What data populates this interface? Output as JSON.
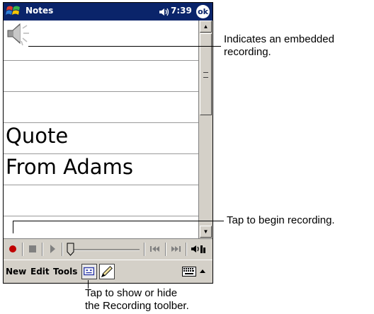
{
  "titlebar": {
    "app_title": "Notes",
    "time": "7:39",
    "ok_label": "ok",
    "bg_color": "#0a246a"
  },
  "note": {
    "lines": [
      "Quote",
      "From Adams"
    ],
    "embedded_recording_icon": "speaker-icon"
  },
  "recording_toolbar": {
    "buttons": [
      "record-icon",
      "stop-icon",
      "play-icon",
      "volume-slider",
      "skip-back-icon",
      "skip-forward-icon",
      "speaker-toggle-icon"
    ],
    "record_color": "#c00000"
  },
  "command_bar": {
    "menus": [
      "New",
      "Edit",
      "Tools"
    ],
    "icons": [
      "recording-toolbar-toggle-icon",
      "pen-icon",
      "keyboard-icon",
      "input-menu-arrow-icon"
    ]
  },
  "callouts": {
    "embedded_recording": [
      "Indicates an embedded",
      "recording."
    ],
    "begin_recording": "Tap to begin recording.",
    "toggle_toolbar": [
      "Tap to show or hide",
      "the Recording toolber."
    ]
  }
}
